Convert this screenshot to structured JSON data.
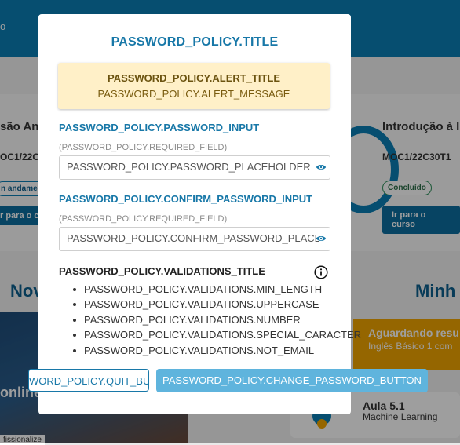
{
  "background": {
    "header_text": "o",
    "card_left": {
      "title": "são Ana",
      "code": "OC1/22C3",
      "status": "n andamen",
      "button": "r para o cu"
    },
    "card_right": {
      "title": "Introdução à I",
      "code": "MOC1/22C30T1",
      "status": "Concluído",
      "button": "Ir para o curso"
    },
    "section_left_heading": "Nov",
    "section_right_heading": "Minh",
    "photo_text": "online",
    "photo_tag": "fissionalize",
    "pending": {
      "title": "Aguardando resu",
      "subtitle": "Inglês Básico 1 com"
    },
    "lesson": {
      "title": "Aula 5.1",
      "subtitle": "Machine Learning"
    }
  },
  "modal": {
    "title": "PASSWORD_POLICY.TITLE",
    "alert": {
      "title": "PASSWORD_POLICY.ALERT_TITLE",
      "message": "PASSWORD_POLICY.ALERT_MESSAGE"
    },
    "password": {
      "label": "PASSWORD_POLICY.PASSWORD_INPUT",
      "hint": "(PASSWORD_POLICY.REQUIRED_FIELD)",
      "placeholder": "PASSWORD_POLICY.PASSWORD_PLACEHOLDER",
      "value": ""
    },
    "confirm": {
      "label": "PASSWORD_POLICY.CONFIRM_PASSWORD_INPUT",
      "hint": "(PASSWORD_POLICY.REQUIRED_FIELD)",
      "placeholder": "PASSWORD_POLICY.CONFIRM_PASSWORD_PLACEHOLDER",
      "value": ""
    },
    "validations": {
      "title": "PASSWORD_POLICY.VALIDATIONS_TITLE",
      "items": [
        "PASSWORD_POLICY.VALIDATIONS.MIN_LENGTH",
        "PASSWORD_POLICY.VALIDATIONS.UPPERCASE",
        "PASSWORD_POLICY.VALIDATIONS.NUMBER",
        "PASSWORD_POLICY.VALIDATIONS.SPECIAL_CARACTER",
        "PASSWORD_POLICY.VALIDATIONS.NOT_EMAIL"
      ]
    },
    "quit_button": "WORD_POLICY.QUIT_BUTTON",
    "change_button": "PASSWORD_POLICY.CHANGE_PASSWORD_BUTTON"
  },
  "icons": {
    "eye": "eye-icon",
    "info": "info-icon"
  },
  "colors": {
    "accent": "#1878a8",
    "primary_button": "#5fb4dd",
    "alert_bg": "#fff0c8",
    "header": "#0a7fb5",
    "pending": "#f0a500"
  }
}
